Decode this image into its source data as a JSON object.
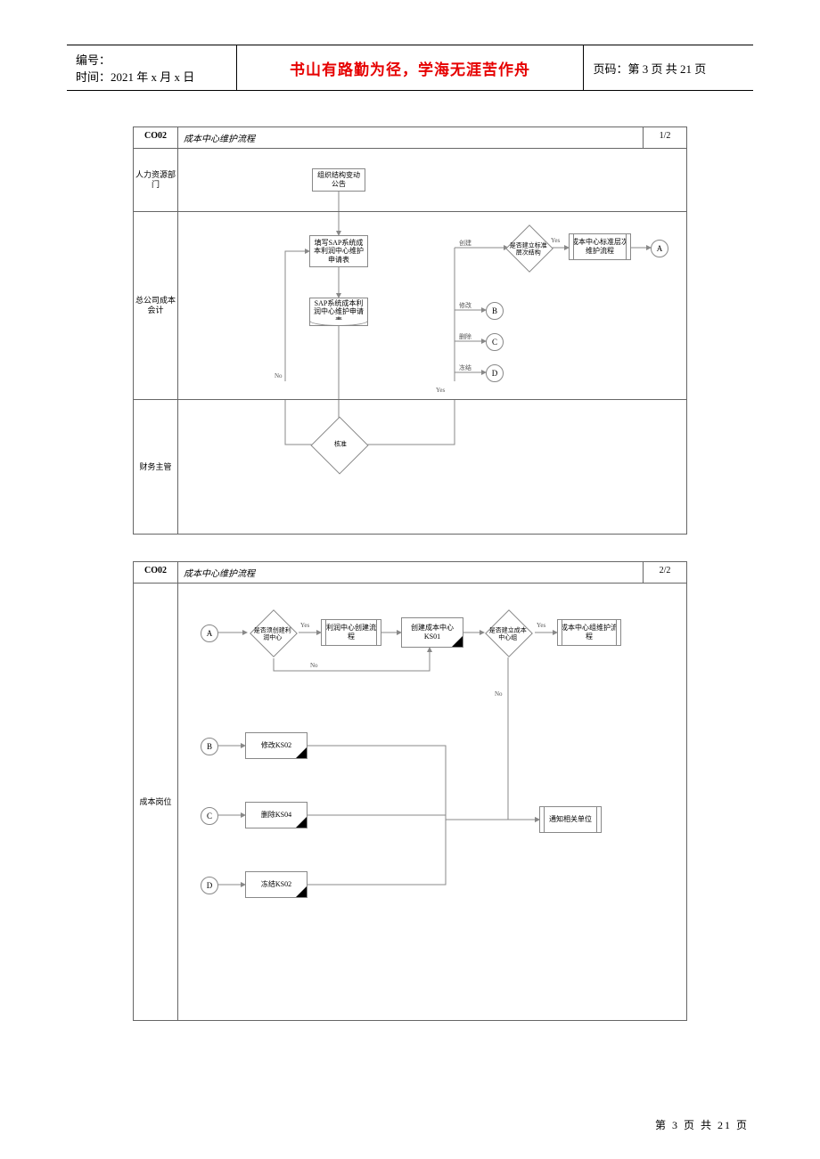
{
  "header": {
    "bianhao_label": "编号：",
    "time_label": "时间：",
    "time_value": "2021 年 x 月 x 日",
    "motto": "书山有路勤为径，学海无涯苦作舟",
    "page_label": "页码：",
    "page_value": "第 3 页 共 21 页"
  },
  "flow1": {
    "code": "CO02",
    "title": "成本中心维护流程",
    "page": "1/2",
    "lanes": {
      "lane1": "人力资源部门",
      "lane2": "总公司成本会计",
      "lane3": "财务主管"
    },
    "nodes": {
      "n_org": "组织结构变动公告",
      "n_fill": "填写SAP系统成本利润中心维护申请表",
      "n_sap": "SAP系统成本利润中心维护申请表",
      "n_appr": "核准",
      "n_std": "是否建立标准层次结构",
      "n_stdproc": "成本中心标准层次维护流程",
      "lbl_create": "创建",
      "lbl_modify": "修改",
      "lbl_delete": "删除",
      "lbl_freeze": "冻结",
      "lbl_yes": "Yes",
      "lbl_no": "No",
      "conn_a": "A",
      "conn_b": "B",
      "conn_c": "C",
      "conn_d": "D"
    }
  },
  "flow2": {
    "code": "CO02",
    "title": "成本中心维护流程",
    "page": "2/2",
    "lanes": {
      "lane1": "成本岗位"
    },
    "nodes": {
      "conn_a": "A",
      "conn_b": "B",
      "conn_c": "C",
      "conn_d": "D",
      "n_profit": "是否须创建利润中心",
      "n_profitproc": "利润中心创建流程",
      "n_create": "创建成本中心KS01",
      "n_group": "是否建立成本中心组",
      "n_groupproc": "成本中心组维护流程",
      "n_ks02": "修改KS02",
      "n_ks04": "删除KS04",
      "n_ks02f": "冻结KS02",
      "n_notify": "通知相关单位",
      "lbl_yes": "Yes",
      "lbl_no": "No"
    }
  },
  "footer": "第  3  页  共  21  页",
  "chart_data": [
    {
      "type": "flowchart",
      "id": "CO02-1/2",
      "title": "成本中心维护流程",
      "swimlanes": [
        "人力资源部门",
        "总公司成本会计",
        "财务主管"
      ],
      "nodes": [
        {
          "id": "org",
          "lane": "人力资源部门",
          "type": "process",
          "label": "组织结构变动公告"
        },
        {
          "id": "fill",
          "lane": "总公司成本会计",
          "type": "process",
          "label": "填写SAP系统成本利润中心维护申请表"
        },
        {
          "id": "sap",
          "lane": "总公司成本会计",
          "type": "document",
          "label": "SAP系统成本利润中心维护申请表"
        },
        {
          "id": "appr",
          "lane": "财务主管",
          "type": "decision",
          "label": "核准"
        },
        {
          "id": "std",
          "lane": "总公司成本会计",
          "type": "decision",
          "label": "是否建立标准层次结构"
        },
        {
          "id": "stdproc",
          "lane": "总公司成本会计",
          "type": "predefined",
          "label": "成本中心标准层次维护流程"
        },
        {
          "id": "A",
          "lane": "总公司成本会计",
          "type": "connector",
          "label": "A"
        },
        {
          "id": "B",
          "lane": "总公司成本会计",
          "type": "connector",
          "label": "B"
        },
        {
          "id": "C",
          "lane": "总公司成本会计",
          "type": "connector",
          "label": "C"
        },
        {
          "id": "D",
          "lane": "总公司成本会计",
          "type": "connector",
          "label": "D"
        }
      ],
      "edges": [
        {
          "from": "org",
          "to": "fill"
        },
        {
          "from": "fill",
          "to": "sap"
        },
        {
          "from": "sap",
          "to": "appr"
        },
        {
          "from": "appr",
          "to": "fill",
          "label": "No"
        },
        {
          "from": "appr",
          "to": "branch",
          "label": "Yes"
        },
        {
          "from": "branch",
          "to": "std",
          "label": "创建"
        },
        {
          "from": "branch",
          "to": "B",
          "label": "修改"
        },
        {
          "from": "branch",
          "to": "C",
          "label": "删除"
        },
        {
          "from": "branch",
          "to": "D",
          "label": "冻结"
        },
        {
          "from": "std",
          "to": "stdproc",
          "label": "Yes"
        },
        {
          "from": "stdproc",
          "to": "A"
        }
      ]
    },
    {
      "type": "flowchart",
      "id": "CO02-2/2",
      "title": "成本中心维护流程",
      "swimlanes": [
        "成本岗位"
      ],
      "nodes": [
        {
          "id": "A",
          "type": "connector",
          "label": "A"
        },
        {
          "id": "profit",
          "type": "decision",
          "label": "是否须创建利润中心"
        },
        {
          "id": "profitproc",
          "type": "predefined",
          "label": "利润中心创建流程"
        },
        {
          "id": "create",
          "type": "process",
          "label": "创建成本中心KS01"
        },
        {
          "id": "group",
          "type": "decision",
          "label": "是否建立成本中心组"
        },
        {
          "id": "groupproc",
          "type": "predefined",
          "label": "成本中心组维护流程"
        },
        {
          "id": "B",
          "type": "connector",
          "label": "B"
        },
        {
          "id": "ks02m",
          "type": "process",
          "label": "修改KS02"
        },
        {
          "id": "C",
          "type": "connector",
          "label": "C"
        },
        {
          "id": "ks04",
          "type": "process",
          "label": "删除KS04"
        },
        {
          "id": "D",
          "type": "connector",
          "label": "D"
        },
        {
          "id": "ks02f",
          "type": "process",
          "label": "冻结KS02"
        },
        {
          "id": "notify",
          "type": "predefined",
          "label": "通知相关单位"
        }
      ],
      "edges": [
        {
          "from": "A",
          "to": "profit"
        },
        {
          "from": "profit",
          "to": "profitproc",
          "label": "Yes"
        },
        {
          "from": "profitproc",
          "to": "create"
        },
        {
          "from": "profit",
          "to": "create",
          "label": "No"
        },
        {
          "from": "create",
          "to": "group"
        },
        {
          "from": "group",
          "to": "groupproc",
          "label": "Yes"
        },
        {
          "from": "group",
          "to": "notify",
          "label": "No"
        },
        {
          "from": "B",
          "to": "ks02m"
        },
        {
          "from": "C",
          "to": "ks04"
        },
        {
          "from": "D",
          "to": "ks02f"
        },
        {
          "from": "ks02m",
          "to": "notify"
        },
        {
          "from": "ks04",
          "to": "notify"
        },
        {
          "from": "ks02f",
          "to": "notify"
        }
      ]
    }
  ]
}
